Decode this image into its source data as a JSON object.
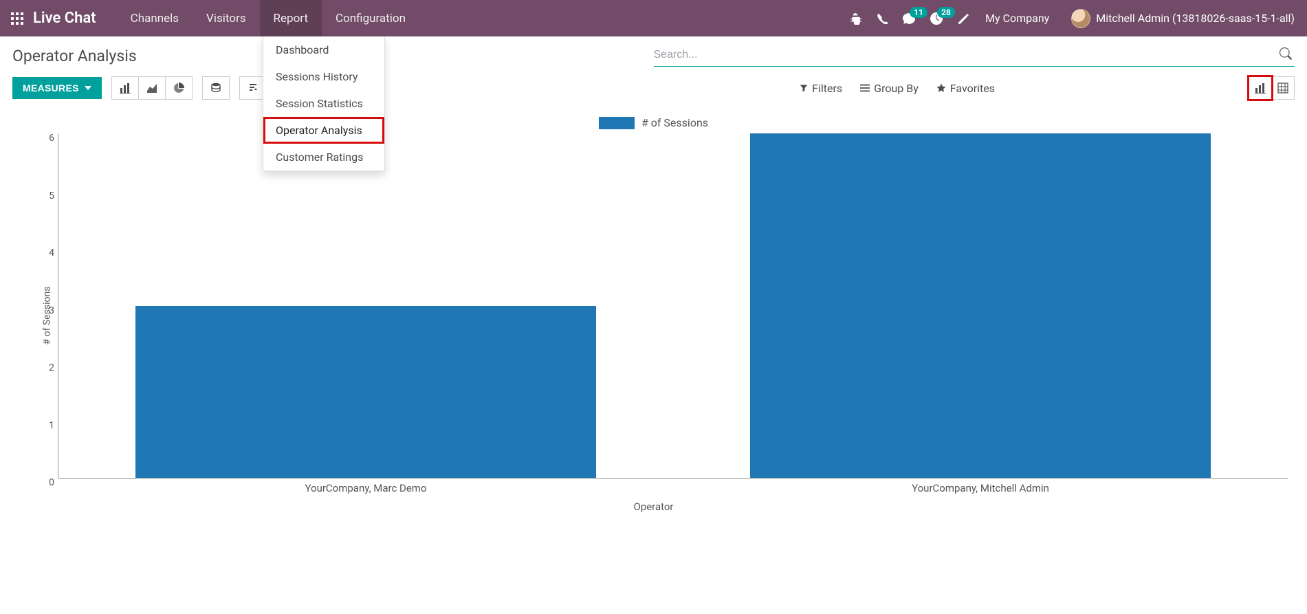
{
  "topbar": {
    "brand": "Live Chat",
    "nav": [
      "Channels",
      "Visitors",
      "Report",
      "Configuration"
    ],
    "active_nav_index": 2,
    "badges": {
      "messages": "11",
      "activities": "28"
    },
    "company": "My Company",
    "user": "Mitchell Admin (13818026-saas-15-1-all)"
  },
  "dropdown": {
    "items": [
      "Dashboard",
      "Sessions History",
      "Session Statistics",
      "Operator Analysis",
      "Customer Ratings"
    ],
    "highlight_index": 3
  },
  "page": {
    "title": "Operator Analysis",
    "search_placeholder": "Search...",
    "measures_label": "MEASURES",
    "filters_label": "Filters",
    "groupby_label": "Group By",
    "favorites_label": "Favorites"
  },
  "chart_data": {
    "type": "bar",
    "categories": [
      "YourCompany, Marc Demo",
      "YourCompany, Mitchell Admin"
    ],
    "values": [
      3,
      6
    ],
    "series": [
      {
        "name": "# of Sessions",
        "values": [
          3,
          6
        ]
      }
    ],
    "legend": "# of Sessions",
    "xlabel": "Operator",
    "ylabel": "# of Sessions",
    "ylim": [
      0,
      6
    ],
    "yticks": [
      0,
      1,
      2,
      3,
      4,
      5,
      6
    ],
    "bar_color": "#1f77b4"
  }
}
